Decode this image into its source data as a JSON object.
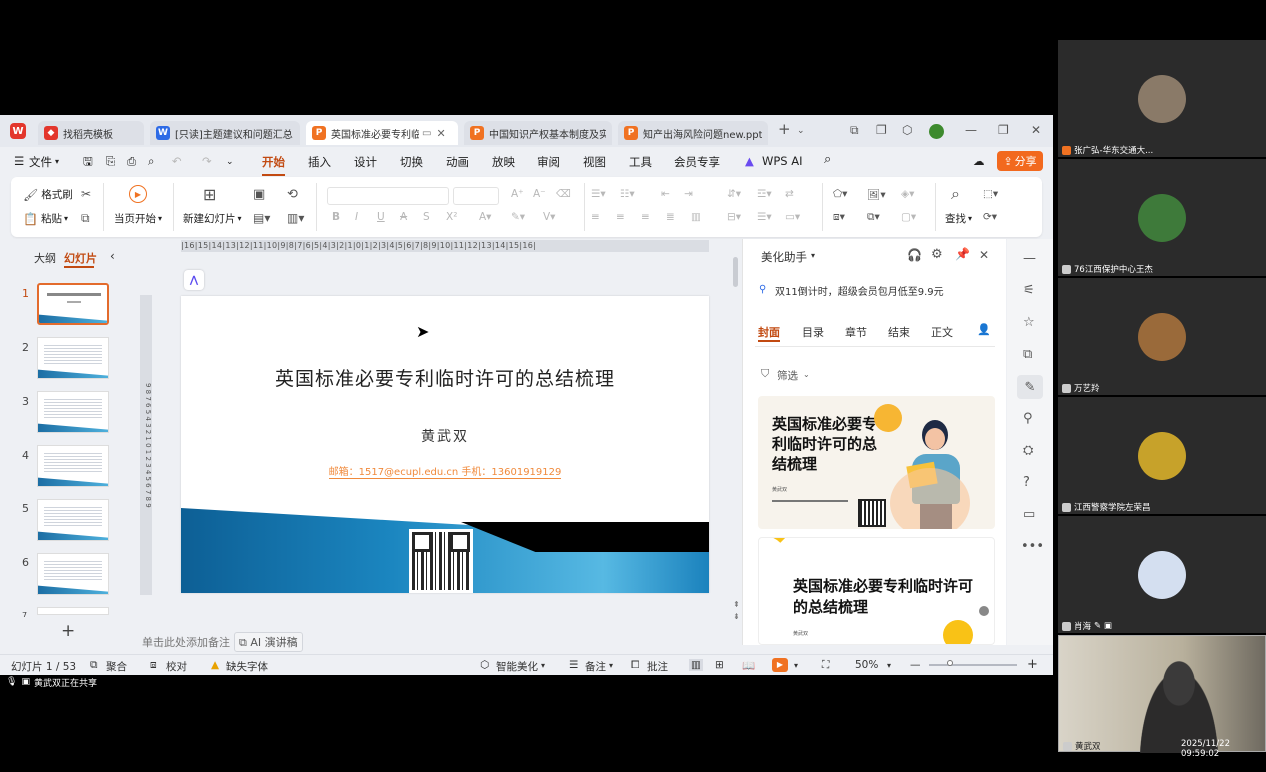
{
  "tabs": [
    {
      "label": "找稻壳模板",
      "icon": "docer-icon"
    },
    {
      "label": "[只读]主题建议和问题汇总",
      "icon": "W"
    },
    {
      "label": "英国标准必要专利临时许可的总结梳理",
      "icon": "P"
    },
    {
      "label": "中国知识产权基本制度及实务",
      "icon": "P"
    },
    {
      "label": "知产出海风险问题new.pptx",
      "icon": "P"
    }
  ],
  "menu": {
    "file": "文件",
    "items": [
      "开始",
      "插入",
      "设计",
      "切换",
      "动画",
      "放映",
      "审阅",
      "视图",
      "工具",
      "会员专享"
    ],
    "wps_ai": "WPS AI",
    "share": "分享"
  },
  "ribbon": {
    "format_painter": "格式刷",
    "paste": "粘贴",
    "from_current": "当页开始",
    "new_slide": "新建幻灯片",
    "find": "查找"
  },
  "left_panel": {
    "outline_tab": "大纲",
    "slides_tab": "幻灯片",
    "slide_numbers": [
      "1",
      "2",
      "3",
      "4",
      "5",
      "6",
      "7"
    ],
    "add_label": "+"
  },
  "slide": {
    "title": "英国标准必要专利临时许可的总结梳理",
    "author": "黄武双",
    "contact": "邮箱：1517@ecupl.edu.cn  手机：13601919129"
  },
  "notes": {
    "placeholder": "单击此处添加备注",
    "ai_script": "AI 演讲稿"
  },
  "beautify": {
    "title": "美化助手",
    "promo": "双11倒计时，超级会员包月低至9.9元",
    "tabs": [
      "封面",
      "目录",
      "章节",
      "结束",
      "正文"
    ],
    "filter": "筛选",
    "card1_title": "英国标准必要专利临时许可的总结梳理",
    "card1_author": "黄武双",
    "card2_title": "英国标准必要专利临时许可的总结梳理",
    "card2_author": "黄武双"
  },
  "status": {
    "slide_count": "幻灯片 1 / 53",
    "merge": "聚合",
    "proofread": "校对",
    "missing_font": "缺失字体",
    "smart_beautify": "智能美化",
    "notes": "备注",
    "comments": "批注",
    "zoom": "50%"
  },
  "share_notice": "黄武双正在共享",
  "participants": [
    {
      "name": "张广弘-华东交通大...",
      "avatar_color": "#8a7a68"
    },
    {
      "name": "76江西保护中心王杰",
      "avatar_color": "#3e7a3a"
    },
    {
      "name": "万艺羚",
      "avatar_color": "#9a6a3a"
    },
    {
      "name": "江西警察学院左荣昌",
      "avatar_color": "#c7a22a"
    },
    {
      "name": "肖海",
      "avatar_color": "#d4dff0"
    },
    {
      "name": "黄武双",
      "avatar_color": "#555555"
    }
  ],
  "timestamp": "2025/11/22 09:59:02"
}
